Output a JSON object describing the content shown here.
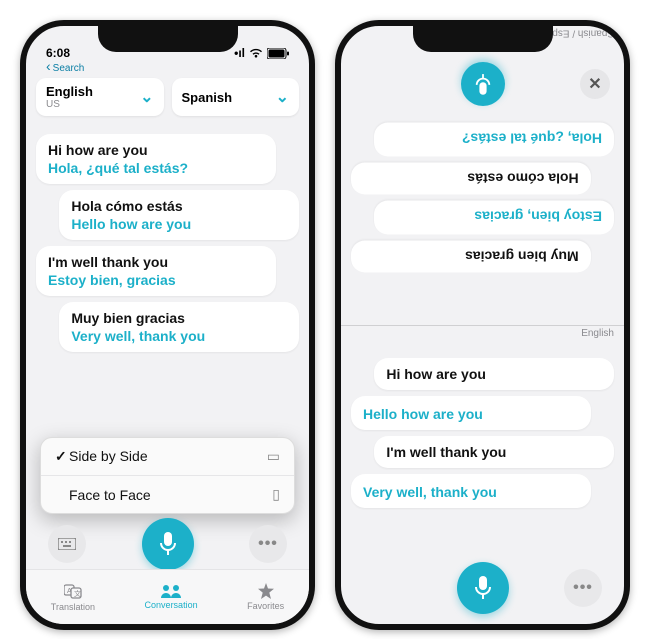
{
  "status": {
    "time": "6:08",
    "signal": "••••",
    "wifi": "􀙇",
    "battery": "􀛨"
  },
  "back_search": "Search",
  "accent": "#1cb0c9",
  "languages": {
    "source": {
      "name": "English",
      "region": "US"
    },
    "target": {
      "name": "Spanish",
      "region": ""
    }
  },
  "conversation": [
    {
      "side": "left",
      "original": "Hi how are you",
      "translated": "Hola, ¿qué tal estás?"
    },
    {
      "side": "right",
      "original": "Hola cómo estás",
      "translated": "Hello how are you"
    },
    {
      "side": "left",
      "original": "I'm well thank you",
      "translated": "Estoy bien, gracias"
    },
    {
      "side": "right",
      "original": "Muy bien gracias",
      "translated": "Very well, thank you"
    }
  ],
  "view_popup": {
    "items": [
      {
        "label": "Side by Side",
        "selected": true,
        "icon": "side-by-side"
      },
      {
        "label": "Face to Face",
        "selected": false,
        "icon": "face-to-face"
      }
    ]
  },
  "tabs": [
    {
      "label": "Translation",
      "active": false
    },
    {
      "label": "Conversation",
      "active": true
    },
    {
      "label": "Favorites",
      "active": false
    }
  ],
  "face_to_face": {
    "top_label": "Spanish / Español",
    "bottom_label": "English",
    "top_bubbles": [
      {
        "text": "Muy bien gracias",
        "type": "orig",
        "side": "right"
      },
      {
        "text": "Estoy bien, gracias",
        "type": "tran",
        "side": "left"
      },
      {
        "text": "Hola cómo estás",
        "type": "orig",
        "side": "right"
      },
      {
        "text": "Hola, ¿qué tal estás?",
        "type": "tran",
        "side": "left"
      }
    ],
    "bottom_bubbles": [
      {
        "text": "Hi how are you",
        "type": "orig",
        "side": "right"
      },
      {
        "text": "Hello how are you",
        "type": "tran",
        "side": "left"
      },
      {
        "text": "I'm well thank you",
        "type": "orig",
        "side": "right"
      },
      {
        "text": "Very well, thank you",
        "type": "tran",
        "side": "left"
      }
    ]
  }
}
